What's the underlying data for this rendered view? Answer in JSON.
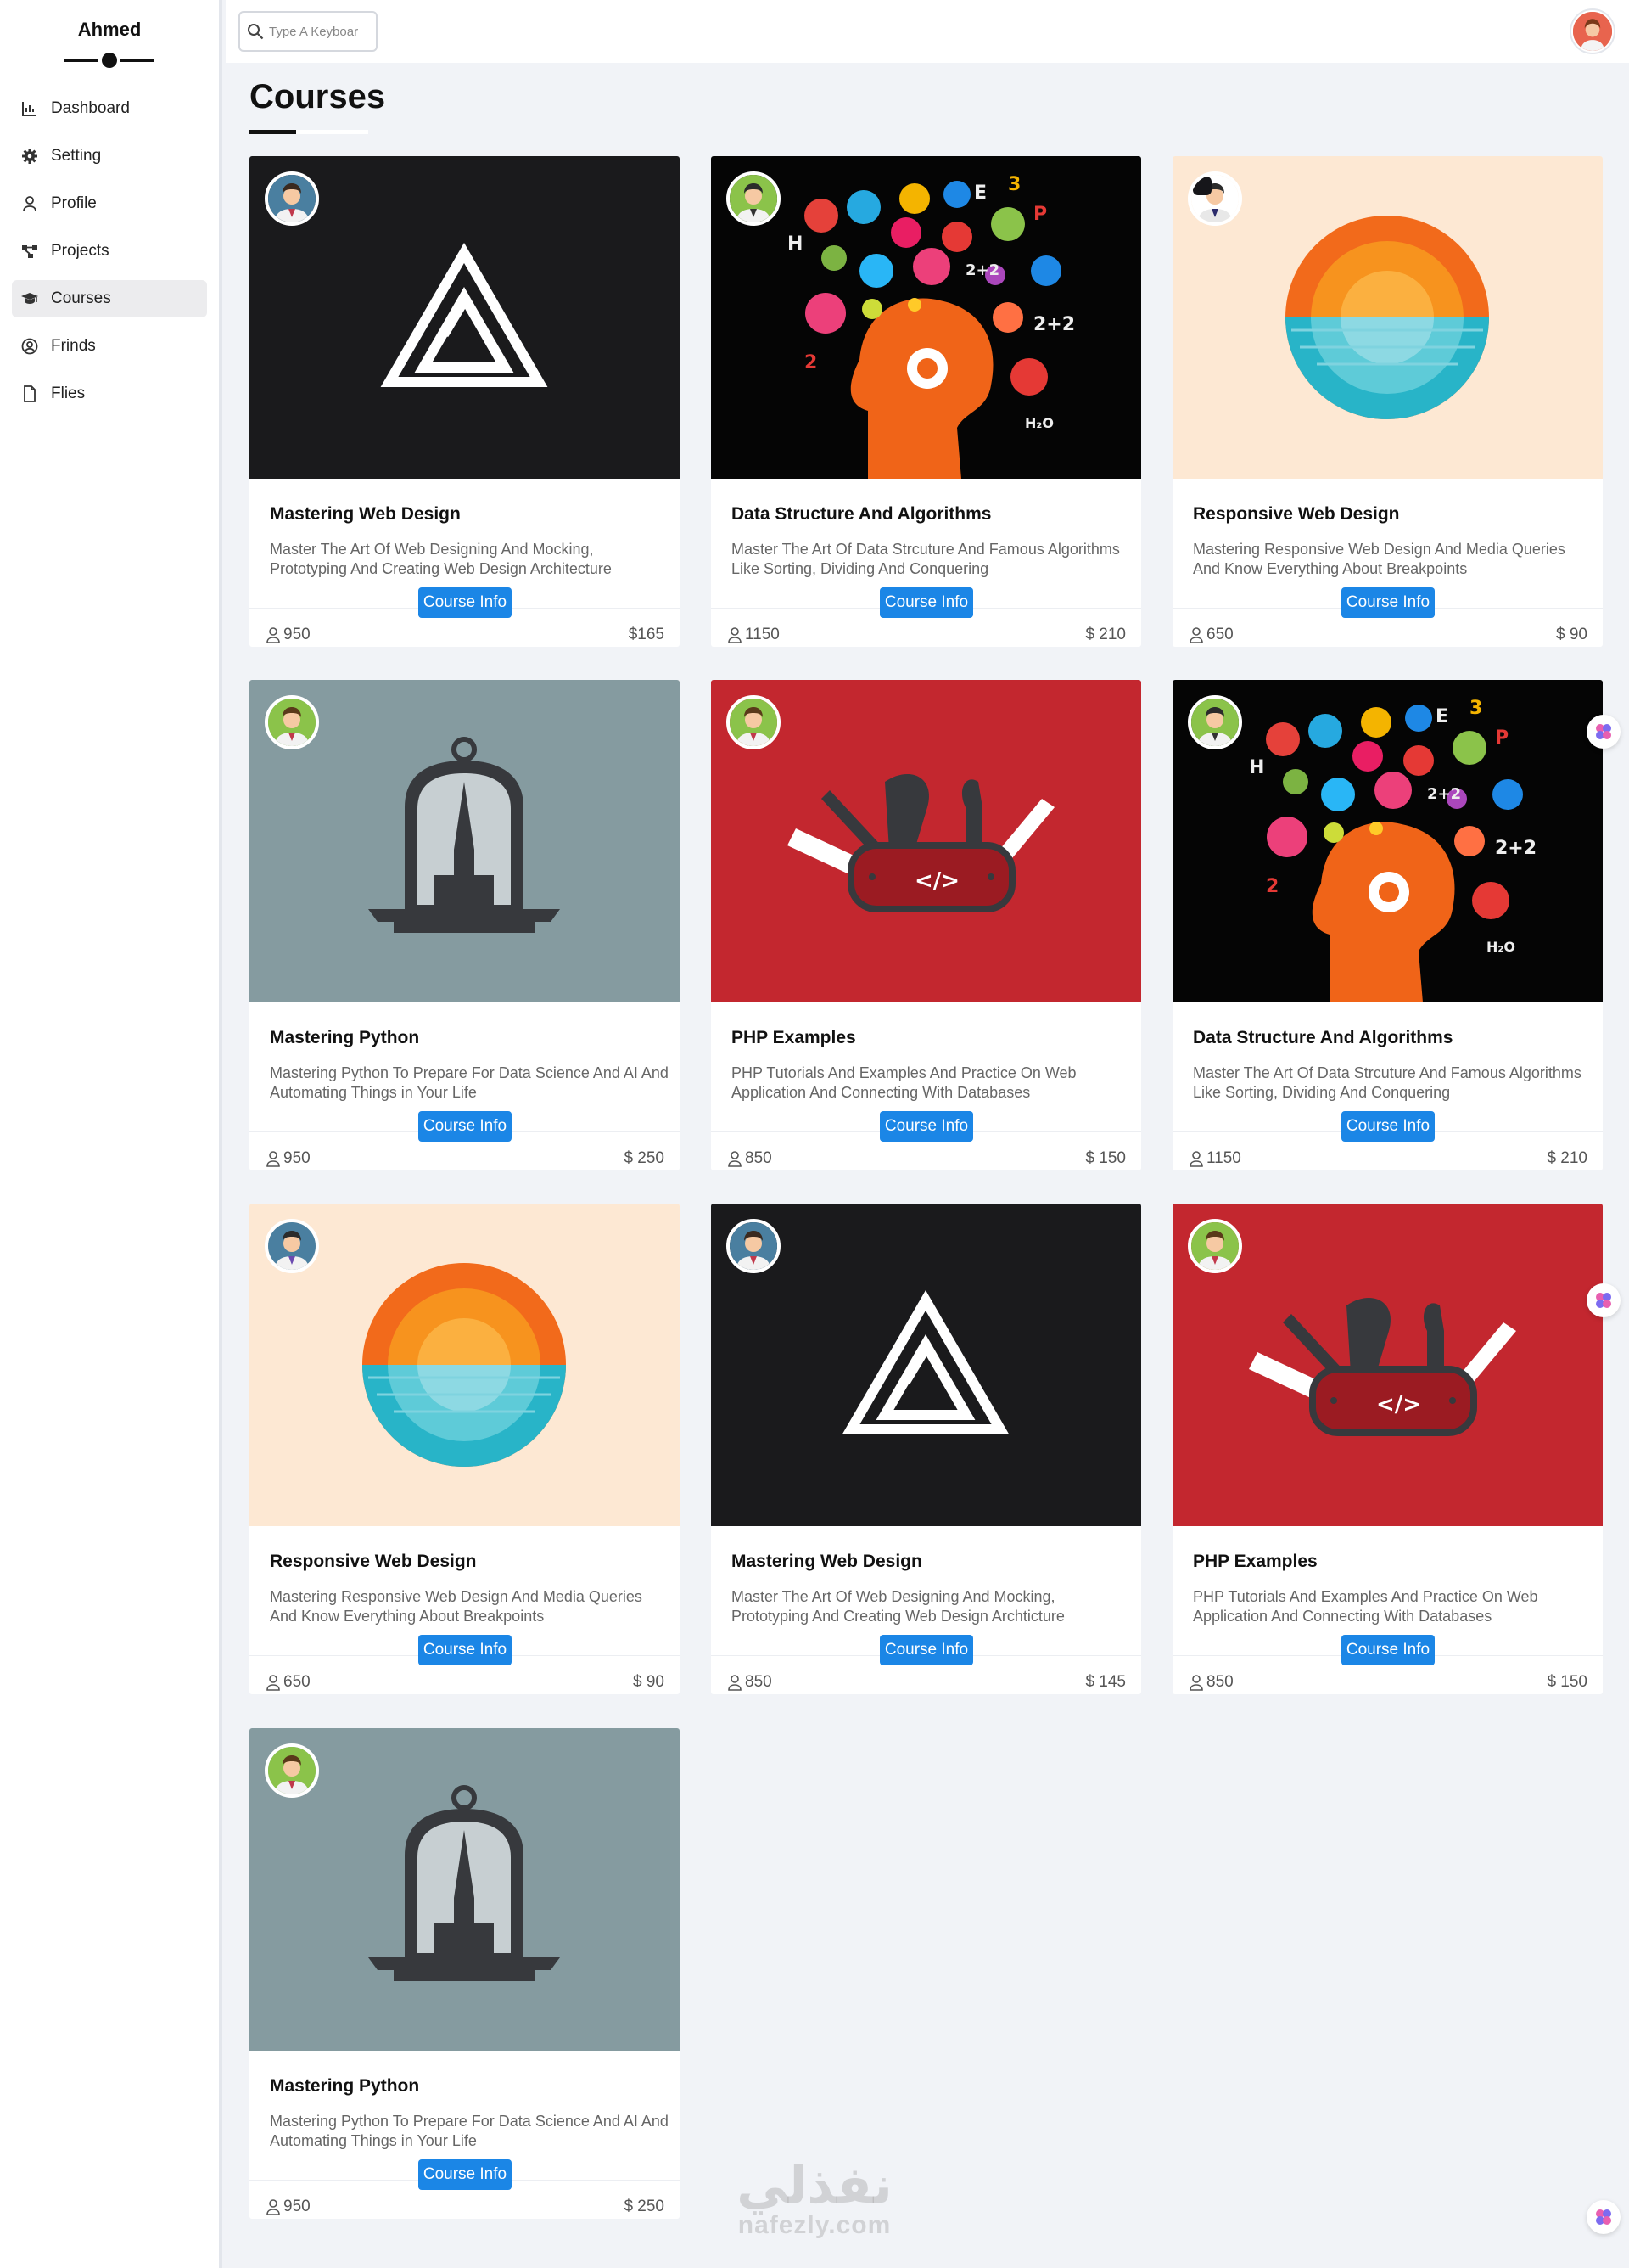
{
  "sidebar": {
    "brand": "Ahmed",
    "items": [
      {
        "label": "Dashboard",
        "icon": "chart-icon"
      },
      {
        "label": "Setting",
        "icon": "gear-icon"
      },
      {
        "label": "Profile",
        "icon": "user-icon"
      },
      {
        "label": "Projects",
        "icon": "diagram-icon"
      },
      {
        "label": "Courses",
        "icon": "graduation-cap-icon",
        "active": true
      },
      {
        "label": "Frinds",
        "icon": "user-circle-icon"
      },
      {
        "label": "Flies",
        "icon": "file-icon"
      }
    ]
  },
  "header": {
    "search_placeholder": "Type A Keyboar"
  },
  "main": {
    "title": "Courses",
    "button_label": "Course Info",
    "courses": [
      {
        "title": "Mastering Web Design",
        "desc": "Master The Art Of Web Designing And Mocking, Prototyping And Creating Web Design Architecture",
        "students": "950",
        "price": "$165",
        "image": "web-design-logo"
      },
      {
        "title": "Data Structure And Algorithms",
        "desc": "Master The Art Of Data Strcuture And Famous Algorithms Like Sorting, Dividing And Conquering",
        "students": "1150",
        "price": "$ 210",
        "image": "data-structure-head"
      },
      {
        "title": "Responsive Web Design",
        "desc": "Mastering Responsive Web Design And Media Queries And Know Everything About Breakpoints",
        "students": "650",
        "price": "$ 90",
        "image": "responsive-sunset"
      },
      {
        "title": "Mastering Python",
        "desc": "Mastering Python To Prepare For Data Science And AI And Automating Things in Your Life",
        "students": "950",
        "price": "$ 250",
        "image": "python-dome"
      },
      {
        "title": "PHP Examples",
        "desc": "PHP Tutorials And Examples And Practice On Web Application And Connecting With Databases",
        "students": "850",
        "price": "$ 150",
        "image": "php-knife"
      },
      {
        "title": "Data Structure And Algorithms",
        "desc": "Master The Art Of Data Strcuture And Famous Algorithms Like Sorting, Dividing And Conquering",
        "students": "1150",
        "price": "$ 210",
        "image": "data-structure-head"
      },
      {
        "title": "Responsive Web Design",
        "desc": "Mastering Responsive Web Design And Media Queries And Know Everything About Breakpoints",
        "students": "650",
        "price": "$ 90",
        "image": "responsive-sunset"
      },
      {
        "title": "Mastering Web Design",
        "desc": "Master The Art Of Web Designing And Mocking, Prototyping And Creating Web Design Archticture",
        "students": "850",
        "price": "$ 145",
        "image": "web-design-logo"
      },
      {
        "title": "PHP Examples",
        "desc": "PHP Tutorials And Examples And Practice On Web Application And Connecting With Databases",
        "students": "850",
        "price": "$ 150",
        "image": "php-knife"
      },
      {
        "title": "Mastering Python",
        "desc": "Mastering Python To Prepare For Data Science And AI And Automating Things in Your Life",
        "students": "950",
        "price": "$ 250",
        "image": "python-dome"
      }
    ]
  },
  "watermark": {
    "arabic": "نفذلي",
    "latin": "nafezly.com"
  },
  "colors": {
    "accent": "#1b86e6",
    "background": "#f1f3f7"
  }
}
